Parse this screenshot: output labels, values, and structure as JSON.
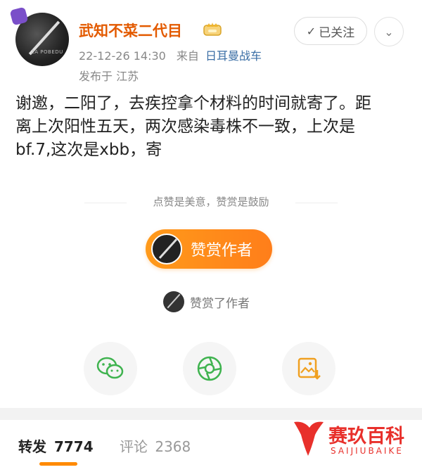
{
  "post": {
    "author": {
      "name": "武知不菜二代目",
      "avatar_tiny_text": "ZA POBEDU"
    },
    "timestamp": "22-12-26 14:30",
    "source_prefix": "来自",
    "source": "日耳曼战车",
    "location": "发布于 江苏",
    "follow_label": "已关注",
    "text": "谢邀，二阳了，去疾控拿个材料的时间就寄了。距\n离上次阳性五天，两次感染毒株不一致，上次是\nbf.7,这次是xbb，寄"
  },
  "reward": {
    "slogan": "点赞是美意，赞赏是鼓励",
    "button_label": "赞赏作者",
    "rewarded_label": "赞赏了作者"
  },
  "share": {
    "icons": [
      "wechat-icon",
      "moments-icon",
      "save-image-icon"
    ]
  },
  "tabs": {
    "repost_label": "转发",
    "repost_count": "7774",
    "comment_label": "评论",
    "comment_count": "2368"
  },
  "watermark": {
    "brand": "赛玖百科",
    "sub": "SAIJIUBAIKE"
  },
  "colors": {
    "username": "#e35a00",
    "accent": "#ff8a00",
    "link": "#3a6ea5",
    "watermark": "#e8302b"
  }
}
